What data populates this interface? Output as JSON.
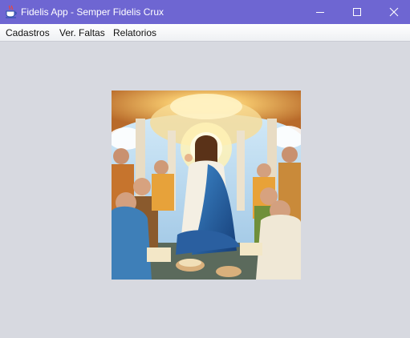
{
  "window": {
    "title": "Fidelis App - Semper Fidelis Crux",
    "app_icon": "java-cup-icon",
    "controls": [
      "minimize-icon",
      "maximize-icon",
      "close-icon"
    ]
  },
  "menu": {
    "items": [
      {
        "label": "Cadastros"
      },
      {
        "label": "Ver. Faltas"
      },
      {
        "label": "Relatorios"
      }
    ]
  },
  "colors": {
    "titlebar": "#6e66d2",
    "background": "#d7d9e0",
    "menubar": "#f6f7f9"
  }
}
